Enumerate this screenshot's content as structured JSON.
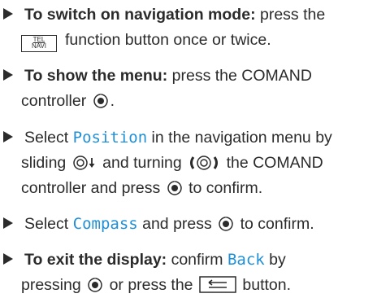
{
  "steps": [
    {
      "lead_bold": "To switch on navigation mode:",
      "lead_text": " press the",
      "cont_key_top": "TEL",
      "cont_key_bottom": "NAVI",
      "cont_text": "function button once or twice."
    },
    {
      "lead_bold": "To show the menu:",
      "lead_text": " press the COMAND",
      "cont_text": "controller"
    },
    {
      "lead_text_a": "Select ",
      "lead_display": "Position",
      "lead_text_b": " in the navigation menu by",
      "cont1_text_a": "sliding",
      "cont1_text_b": "and turning",
      "cont1_text_c": "the COMAND",
      "cont2_text_a": "controller and press",
      "cont2_text_b": "to confirm."
    },
    {
      "lead_text_a": "Select ",
      "lead_display": "Compass",
      "lead_text_b": " and press",
      "lead_text_c": "to confirm."
    },
    {
      "lead_bold": "To exit the display:",
      "lead_text": " confirm ",
      "lead_display": "Back",
      "lead_text_b": " by",
      "cont_text_a": "pressing",
      "cont_text_b": "or press the",
      "cont_text_c": "button."
    }
  ],
  "icons": {
    "press_controller": "controller-press-icon",
    "slide_controller": "controller-slide-down-icon",
    "turn_controller": "controller-turn-icon",
    "back_button": "back-button-icon",
    "tel_navi_button": "tel-navi-button-icon"
  },
  "colors": {
    "text": "#2b2b2b",
    "display_text": "#1f8fd6"
  }
}
